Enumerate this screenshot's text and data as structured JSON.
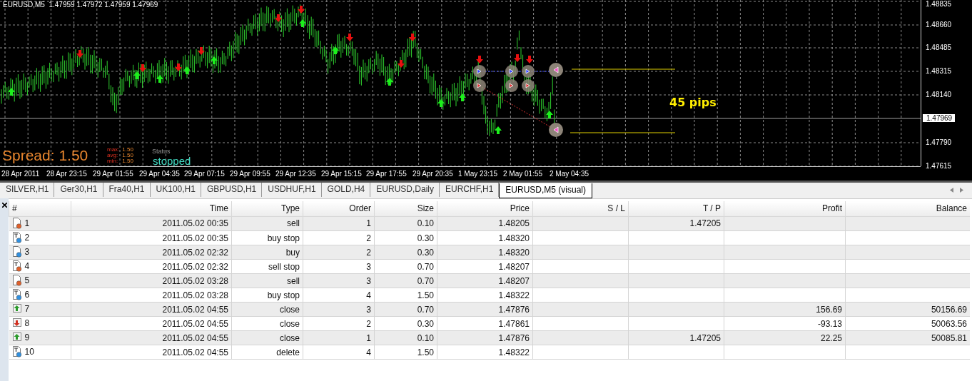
{
  "chart": {
    "symbol_info": "EURUSD,M5  1.47959 1.47972 1.47959 1.47969",
    "price_labels": [
      "1.48835",
      "1.48660",
      "1.48485",
      "1.48315",
      "1.48140",
      "1.47790",
      "1.47615"
    ],
    "current_price": "1.47969",
    "time_labels": [
      "28 Apr 2011",
      "28 Apr 23:15",
      "29 Apr 01:55",
      "29 Apr 04:35",
      "29 Apr 07:15",
      "29 Apr 09:55",
      "29 Apr 12:35",
      "29 Apr 15:15",
      "29 Apr 17:55",
      "29 Apr 20:35",
      "1 May 23:15",
      "2 May 01:55",
      "2 May 04:35"
    ],
    "pips_label": "45 pips",
    "spread": {
      "label": "Spread: 1.50",
      "stats": [
        {
          "label": "max:",
          "value": "1.50"
        },
        {
          "label": "avg:",
          "value": "1.50"
        },
        {
          "label": "min:",
          "value": "1.50"
        }
      ]
    },
    "status": {
      "label": "Status",
      "value": "stopped"
    }
  },
  "tabs": [
    {
      "label": "SILVER,H1",
      "selected": false
    },
    {
      "label": "Ger30,H1",
      "selected": false
    },
    {
      "label": "Fra40,H1",
      "selected": false
    },
    {
      "label": "UK100,H1",
      "selected": false
    },
    {
      "label": "GBPUSD,H1",
      "selected": false
    },
    {
      "label": "USDHUF,H1",
      "selected": false
    },
    {
      "label": "GOLD,H4",
      "selected": false
    },
    {
      "label": "EURUSD,Daily",
      "selected": false
    },
    {
      "label": "EURCHF,H1",
      "selected": false
    },
    {
      "label": "EURUSD,M5 (visual)",
      "selected": true
    }
  ],
  "table": {
    "columns": [
      "#",
      "Time",
      "Type",
      "Order",
      "Size",
      "Price",
      "S / L",
      "T / P",
      "Profit",
      "Balance"
    ],
    "rows": [
      {
        "kind": "market_sell",
        "number": "1",
        "time": "2011.05.02 00:35",
        "type": "sell",
        "order": "1",
        "size": "0.10",
        "price": "1.48205",
        "tp": "1.47205"
      },
      {
        "kind": "pending_buy",
        "number": "2",
        "time": "2011.05.02 00:35",
        "type": "buy stop",
        "order": "2",
        "size": "0.30",
        "price": "1.48320"
      },
      {
        "kind": "market_buy",
        "number": "3",
        "time": "2011.05.02 02:32",
        "type": "buy",
        "order": "2",
        "size": "0.30",
        "price": "1.48320"
      },
      {
        "kind": "pending_sell",
        "number": "4",
        "time": "2011.05.02 02:32",
        "type": "sell stop",
        "order": "3",
        "size": "0.70",
        "price": "1.48207"
      },
      {
        "kind": "market_sell",
        "number": "5",
        "time": "2011.05.02 03:28",
        "type": "sell",
        "order": "3",
        "size": "0.70",
        "price": "1.48207"
      },
      {
        "kind": "pending_buy",
        "number": "6",
        "time": "2011.05.02 03:28",
        "type": "buy stop",
        "order": "4",
        "size": "1.50",
        "price": "1.48322"
      },
      {
        "kind": "close_profit",
        "number": "7",
        "time": "2011.05.02 04:55",
        "type": "close",
        "order": "3",
        "size": "0.70",
        "price": "1.47876",
        "profit": "156.69",
        "balance": "50156.69"
      },
      {
        "kind": "close_loss",
        "number": "8",
        "time": "2011.05.02 04:55",
        "type": "close",
        "order": "2",
        "size": "0.30",
        "price": "1.47861",
        "profit": "-93.13",
        "balance": "50063.56"
      },
      {
        "kind": "close_profit",
        "number": "9",
        "time": "2011.05.02 04:55",
        "type": "close",
        "order": "1",
        "size": "0.10",
        "price": "1.47876",
        "tp": "1.47205",
        "profit": "22.25",
        "balance": "50085.81"
      },
      {
        "kind": "pending_buy",
        "number": "10",
        "time": "2011.05.02 04:55",
        "type": "delete",
        "order": "4",
        "size": "1.50",
        "price": "1.48322"
      }
    ]
  }
}
